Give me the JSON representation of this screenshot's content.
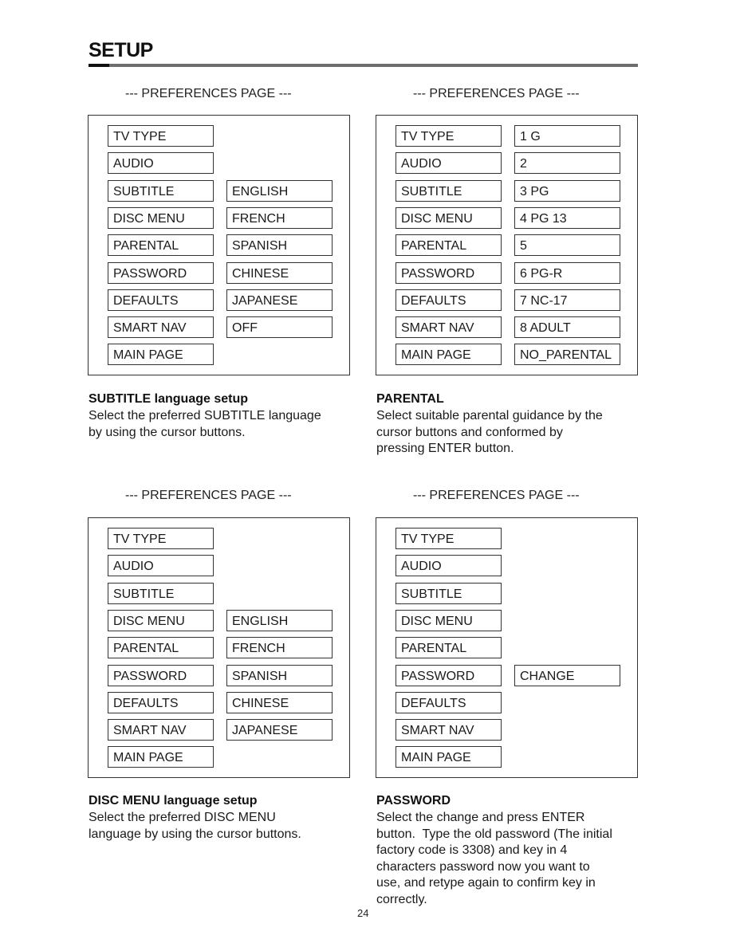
{
  "page": {
    "title": "SETUP",
    "page_number": "24"
  },
  "panels": [
    {
      "header": "--- PREFERENCES PAGE ---",
      "menu": [
        "TV TYPE",
        "AUDIO",
        "SUBTITLE",
        "DISC MENU",
        "PARENTAL",
        "PASSWORD",
        "DEFAULTS",
        "SMART NAV",
        "MAIN PAGE"
      ],
      "active_item": "SUBTITLE",
      "options": [
        "ENGLISH",
        "FRENCH",
        "SPANISH",
        "CHINESE",
        "JAPANESE",
        "OFF"
      ],
      "options_start_row": 2,
      "heading": "SUBTITLE language setup",
      "description_lines": [
        "Select the preferred SUBTITLE language",
        "by using the cursor buttons."
      ]
    },
    {
      "header": "--- PREFERENCES PAGE ---",
      "menu": [
        "TV TYPE",
        "AUDIO",
        "SUBTITLE",
        "DISC MENU",
        "PARENTAL",
        "PASSWORD",
        "DEFAULTS",
        "SMART NAV",
        "MAIN PAGE"
      ],
      "active_item": "PARENTAL",
      "options": [
        "1 G",
        "2",
        "3 PG",
        "4 PG 13",
        "5",
        "6 PG-R",
        "7 NC-17",
        "8 ADULT",
        "NO_PARENTAL"
      ],
      "options_start_row": 0,
      "heading": "PARENTAL",
      "description_lines": [
        "Select suitable parental guidance by the",
        "cursor buttons and conformed by",
        "pressing ENTER button."
      ]
    },
    {
      "header": "--- PREFERENCES PAGE ---",
      "menu": [
        "TV TYPE",
        "AUDIO",
        "SUBTITLE",
        "DISC MENU",
        "PARENTAL",
        "PASSWORD",
        "DEFAULTS",
        "SMART NAV",
        "MAIN PAGE"
      ],
      "active_item": "DISC MENU",
      "options": [
        "ENGLISH",
        "FRENCH",
        "SPANISH",
        "CHINESE",
        "JAPANESE"
      ],
      "options_start_row": 3,
      "heading": "DISC MENU language setup",
      "description_lines": [
        "Select the preferred DISC MENU",
        "language by using the cursor buttons."
      ]
    },
    {
      "header": "--- PREFERENCES PAGE ---",
      "menu": [
        "TV TYPE",
        "AUDIO",
        "SUBTITLE",
        "DISC MENU",
        "PARENTAL",
        "PASSWORD",
        "DEFAULTS",
        "SMART NAV",
        "MAIN PAGE"
      ],
      "active_item": "PASSWORD",
      "options": [
        "CHANGE"
      ],
      "options_start_row": 5,
      "heading": "PASSWORD",
      "description_lines": [
        "Select the change and press ENTER",
        "button.  Type the old password (The initial",
        "factory code is 3308) and key in 4",
        "characters password now you want to",
        "use, and retype again to confirm key in",
        "correctly."
      ]
    }
  ]
}
